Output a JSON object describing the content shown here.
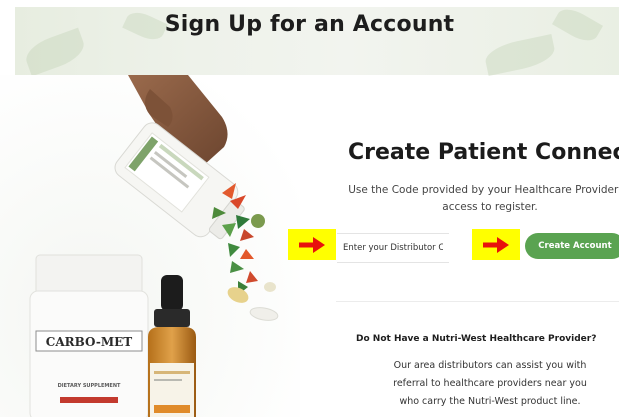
{
  "header": {
    "title": "Sign Up for an Account"
  },
  "hero": {
    "bottle_brand": "CARBO-MET",
    "bottle_caption": "DIETARY SUPPLEMENT"
  },
  "patient_connect": {
    "title": "Create Patient Connect",
    "instruction_line1": "Use the Code provided by your Healthcare Provider fo",
    "instruction_line2": "access to register.",
    "distributor_placeholder": "Enter your Distributor C",
    "distributor_value": "",
    "create_button_label": "Create Account",
    "accent_color": "#5aa351",
    "highlight_color": "#ffff00",
    "arrow_color": "#e8120c"
  },
  "no_provider": {
    "title": "Do Not Have a Nutri-West Healthcare Provider?",
    "line1": "Our area distributors can assist you with",
    "line2": "referral to healthcare providers near you",
    "line3": "who carry the Nutri-West product line."
  },
  "icons": [
    "arrow-right-icon",
    "arrow-right-icon"
  ]
}
